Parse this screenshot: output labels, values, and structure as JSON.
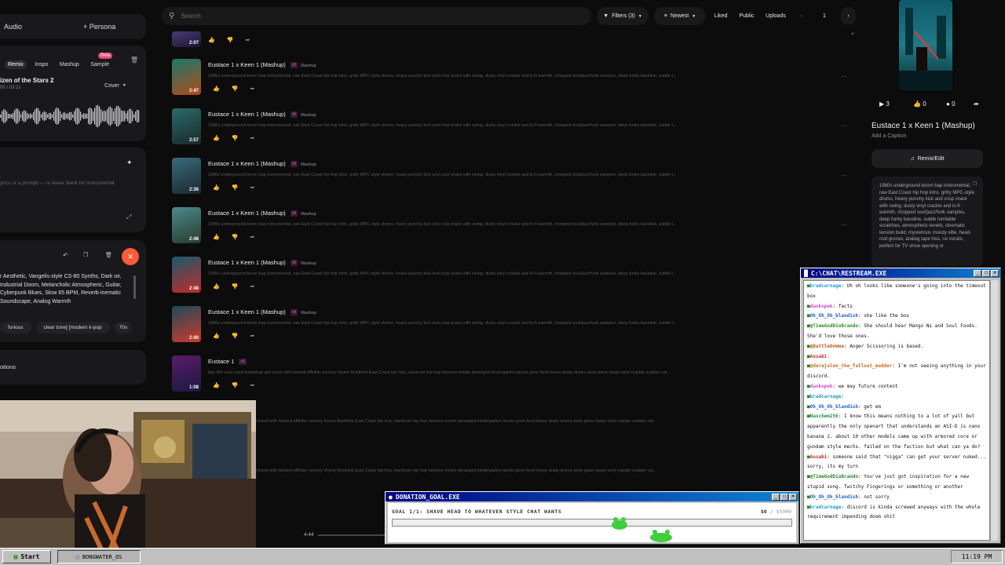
{
  "left": {
    "audio_label": "Audio",
    "persona_label": "Persona",
    "tabs": [
      "Remix",
      "Inspo",
      "Mashup",
      "Sample"
    ],
    "beta": "Beta",
    "song_title": "izen of the Stars 2",
    "song_time": "00 / 03:21",
    "cover_label": "Cover",
    "lyrics_placeholder": "yrics or a prompt — or leave blank for instrumental",
    "styles_text": "r Aesthetic, Vangelis-style CS-80 Synths, Dark oir, Industrial Doom, Melancholic Atmospheric, Guitar, Cyberpunk Blues, Slow 65 BPM, Reverb-inematic Soundscape, Analog Warmth",
    "style_chips": [
      "furious",
      "clear tone] [modern k-pop",
      "70s"
    ],
    "options_label": "otions"
  },
  "topbar": {
    "search_placeholder": "Search",
    "filters": "Filters (3)",
    "sort": "Newest",
    "liked": "Liked",
    "public": "Public",
    "uploads": "Uploads",
    "page": "1"
  },
  "rows": [
    {
      "title": "Eustace 1 x Keen 1 (Mashup)",
      "genre": "Mashup",
      "dur": "2:47",
      "desc": "1980s underground boom bap instrumental, raw East Coast hip hop intro, gritty MPC-style drums, heavy punchy kick and crisp snare with swing, dusty vinyl crackle and lo-fi warmth, chopped soul/jazz/funk samples, deep funky bassline, subtle t..."
    },
    {
      "title": "Eustace 1 x Keen 1 (Mashup)",
      "genre": "Mashup",
      "dur": "2:57",
      "desc": "1980s underground boom bap instrumental, raw East Coast hip hop intro, gritty MPC-style drums, heavy punchy kick and crisp snare with swing, dusty vinyl crackle and lo-fi warmth, chopped soul/jazz/funk samples, deep funky bassline, subtle t..."
    },
    {
      "title": "Eustace 1 x Keen 1 (Mashup)",
      "genre": "Mashup",
      "dur": "2:36",
      "desc": "1980s underground boom bap instrumental, raw East Coast hip hop intro, gritty MPC-style drums, heavy punchy kick and crisp snare with swing, dusty vinyl crackle and lo-fi warmth, chopped soul/jazz/funk samples, deep funky bassline, subtle t..."
    },
    {
      "title": "Eustace 1 x Keen 1 (Mashup)",
      "genre": "Mashup",
      "dur": "2:48",
      "desc": "1980s underground boom bap instrumental, raw East Coast hip hop intro, gritty MPC-style drums, heavy punchy kick and crisp snare with swing, dusty vinyl crackle and lo-fi warmth, chopped soul/jazz/funk samples, deep funky bassline, subtle t..."
    },
    {
      "title": "Eustace 1 x Keen 1 (Mashup)",
      "genre": "Mashup",
      "dur": "2:48",
      "desc": "1980s underground boom bap instrumental, raw East Coast hip hop intro, gritty MPC-style drums, heavy punchy kick and crisp snare with swing, dusty vinyl crackle and lo-fi warmth, chopped soul/jazz/funk samples, deep funky bassline, subtle t..."
    },
    {
      "title": "Eustace 1 x Keen 1 (Mashup)",
      "genre": "Mashup",
      "dur": "2:40",
      "desc": "1980s underground boom bap instrumental, raw East Coast hip hop intro, gritty MPC-style drums, heavy punchy kick and crisp snare with swing, dusty vinyl crackle and lo-fi warmth, chopped soul/jazz/funk samples, deep funky bassline, subtle t..."
    },
    {
      "title": "Eustace 1",
      "genre": "",
      "dur": "1:08",
      "desc": "late 90s east coast boombap grit fused with twisted offkilter nursery rhyme flowthink East Coast hip hop, Hardcore hip hop menace meets deranged kindergarten taunts gone feral heavy dusty drums eerie piano loops vinyl crackle sudden cat..."
    }
  ],
  "ghost_desc": "ombap grit fused with twisted offkilter nursery rhyme flowthink East Coast hip hop, Hardcore hip hop menace meets deranged kindergarten taunts gone feral heavy dusty drums eerie piano loops vinyl crackle sudden cat...",
  "ghost_desc2": "ombap grit fused with twisted offkilter nursery rhyme flowthink East Coast hip hop, Hardcore hip hop menace meets deranged kindergarten taunts gone feral heavy dusty drums eerie piano loops vinyl crackle sudden cat...",
  "right": {
    "plays": "3",
    "likes": "0",
    "comments": "0",
    "title": "Eustace 1 x Keen 1 (Mashup)",
    "caption": "Add a Caption",
    "remix": "Remix/Edit",
    "desc": "1980s underground boom bap instrumental, raw East Coast hip hop intro, gritty MPC-style drums, heavy punchy kick and crisp snare with swing, dusty vinyl crackle and lo-fi warmth, chopped soul/jazz/funk samples, deep funky bassline, subtle turntable scratches, atmospheric reverb, cinematic tension build, mysterious moody vibe, head-nod groove, analog tape hiss, no vocals, perfect for TV show opening or"
  },
  "player_time": "4:44",
  "chat": {
    "title": "C:\\CHAT\\RESTREAM.EXE",
    "messages": [
      {
        "user": "bradcarnage",
        "text": "Uh oh looks like someone's going into the timeout box",
        "color": "#1a9ad8"
      },
      {
        "user": "dankopek",
        "text": "facts",
        "color": "#d04bd0"
      },
      {
        "user": "Oh_Oh_Oh_blandish",
        "text": "she like the box",
        "color": "#2060d0"
      },
      {
        "user": "@TimeGodDioBrando",
        "text": "She should hear Mango Ns and Soul Foods. She'd love those ones.",
        "color": "#2a8a2a"
      },
      {
        "user": "@BattleOnWee",
        "text": "Anger Scissoring is based.",
        "color": "#c05a1a"
      },
      {
        "user": "Aosabi",
        "text": "",
        "color": "#d02a2a"
      },
      {
        "user": "@derejalen_the_fallout_modder",
        "text": "I'm not seeing anything in your discord.",
        "color": "#d06a1a"
      },
      {
        "user": "dankopek",
        "text": "we may future content",
        "color": "#d04bd0"
      },
      {
        "user": "bradcarnage",
        "text": "",
        "color": "#1a9ad8"
      },
      {
        "user": "Oh_Oh_Oh_blandish",
        "text": "get em",
        "color": "#2060d0"
      },
      {
        "user": "Naschem256",
        "text": "I know this means nothing to a lot of yall but apparently the only openart that understands an ASI-D is nano banana 2. about 10 other models came up with armored core or gundam style mechs. failed on the faction but what can ya do?",
        "color": "#2a8a4a"
      },
      {
        "user": "Aosabi",
        "text": "someone said that \"nigga\" can get your server nuked... sorry, its my turn",
        "color": "#d02a2a"
      },
      {
        "user": "@TimeGodDioBrando",
        "text": "You've just got inspiration for a new stupid song. Twitchy Fingerings or something or another",
        "color": "#2a8a2a"
      },
      {
        "user": "Oh_Oh_Oh_blandish",
        "text": "not sorry",
        "color": "#2060d0"
      },
      {
        "user": "bradcarnage",
        "text": "discord is kinda screwed anyways with the whole requirement impending doom shit",
        "color": "#1a9ad8"
      }
    ]
  },
  "donation": {
    "title": "DONATION_GOAL.EXE",
    "goal": "GOAL 1/1: SHAVE HEAD TO WHATEVER STYLE CHAT WANTS",
    "current": "$0",
    "target": "/ $5000",
    "progress": 0
  },
  "taskbar": {
    "start": "Start",
    "app": "BONGWATER_OS",
    "clock": "11:19 PM"
  },
  "colors": {
    "accent": "#e6467a",
    "record": "#ff5a36",
    "win_title": "#000080"
  }
}
